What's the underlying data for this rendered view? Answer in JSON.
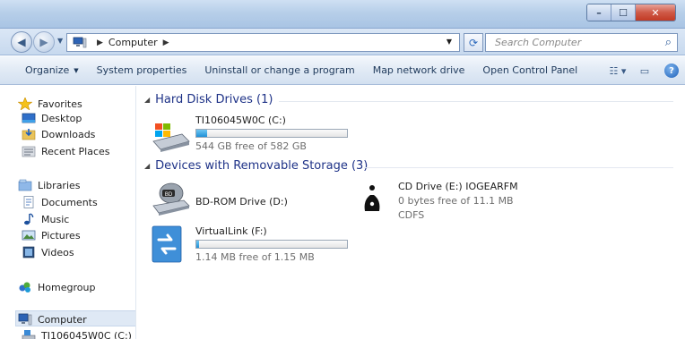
{
  "window": {
    "minimize": "–",
    "maximize": "☐",
    "close": "✕"
  },
  "address": {
    "location": "Computer",
    "search_placeholder": "Search Computer"
  },
  "toolbar": {
    "organize": "Organize",
    "system_properties": "System properties",
    "uninstall": "Uninstall or change a program",
    "map_drive": "Map network drive",
    "control_panel": "Open Control Panel"
  },
  "sidebar": {
    "favorites": "Favorites",
    "desktop": "Desktop",
    "downloads": "Downloads",
    "recent": "Recent Places",
    "libraries": "Libraries",
    "documents": "Documents",
    "music": "Music",
    "pictures": "Pictures",
    "videos": "Videos",
    "homegroup": "Homegroup",
    "computer": "Computer",
    "drive_c": "TI106045W0C (C:)"
  },
  "groups": {
    "hdd": "Hard Disk Drives (1)",
    "removable": "Devices with Removable Storage (3)"
  },
  "drives": {
    "c": {
      "name": "TI106045W0C (C:)",
      "free": "544 GB free of 582 GB",
      "used_fraction": 0.07
    },
    "bd": {
      "name": "BD-ROM Drive (D:)",
      "icon_label": "BD"
    },
    "cd": {
      "name": "CD Drive (E:) IOGEARFM",
      "free": "0 bytes free of 11.1 MB",
      "fs": "CDFS"
    },
    "f": {
      "name": "VirtualLink (F:)",
      "free": "1.14 MB free of 1.15 MB",
      "used_fraction": 0.01
    }
  }
}
